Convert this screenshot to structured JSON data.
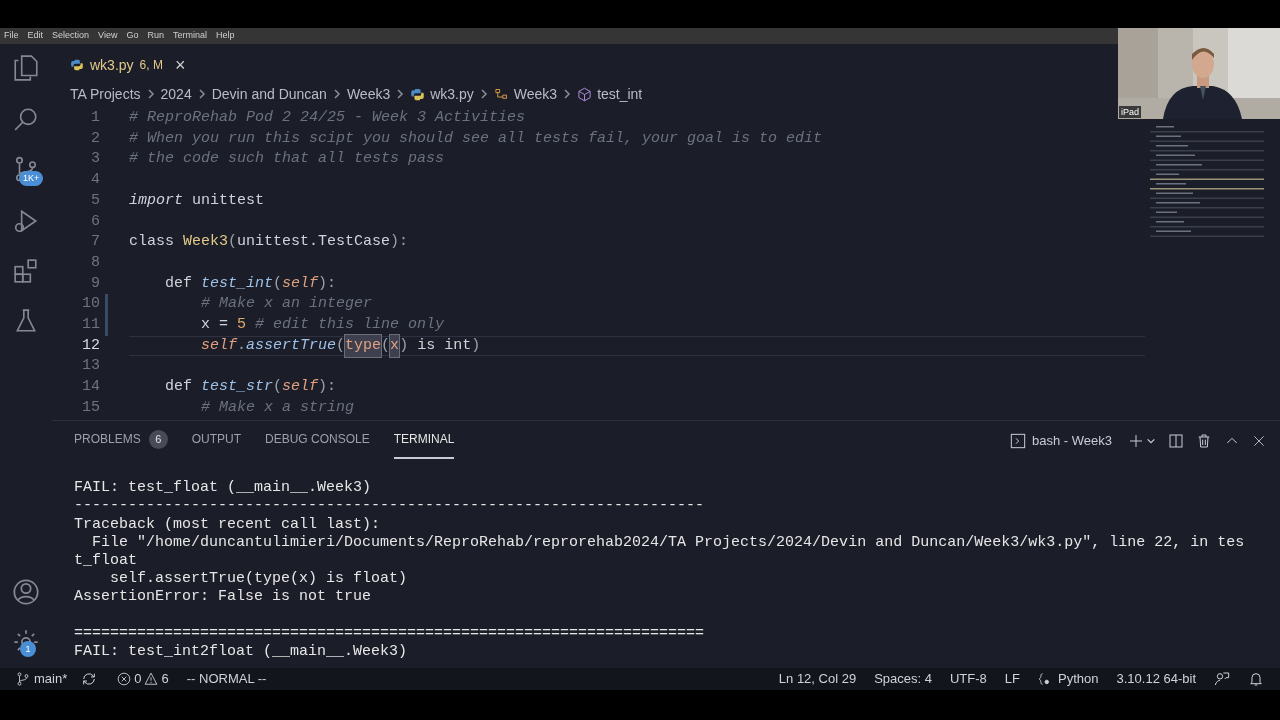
{
  "menu_bar": [
    "File",
    "Edit",
    "Selection",
    "View",
    "Go",
    "Run",
    "Terminal",
    "Help"
  ],
  "activity_bar": {
    "source_control_badge": "1K+",
    "settings_badge": "1"
  },
  "editor_tab": {
    "filename": "wk3.py",
    "status": "6, M",
    "close": "×"
  },
  "breadcrumbs": [
    {
      "text": "TA Projects",
      "kind": "folder"
    },
    {
      "text": "2024",
      "kind": "folder"
    },
    {
      "text": "Devin and Duncan",
      "kind": "folder"
    },
    {
      "text": "Week3",
      "kind": "folder"
    },
    {
      "text": "wk3.py",
      "kind": "python"
    },
    {
      "text": "Week3",
      "kind": "class"
    },
    {
      "text": "test_int",
      "kind": "method"
    }
  ],
  "code_lines": [
    {
      "number": "1",
      "current": false,
      "modified": false,
      "segments": [
        {
          "text": "# ReproRehab Pod 2 24/25 - Week 3 Activities",
          "kind": "comment"
        }
      ]
    },
    {
      "number": "2",
      "current": false,
      "modified": false,
      "segments": [
        {
          "text": "# When you run this scipt you should see all tests fail, your goal is to edit",
          "kind": "comment"
        }
      ]
    },
    {
      "number": "3",
      "current": false,
      "modified": false,
      "segments": [
        {
          "text": "# the code such that all tests pass",
          "kind": "comment"
        }
      ]
    },
    {
      "number": "4",
      "current": false,
      "modified": false
    },
    {
      "number": "5",
      "current": false,
      "modified": false,
      "segments": [
        {
          "text": "import",
          "kind": "keyword"
        },
        {
          "text": " unittest",
          "kind": "plain"
        }
      ]
    },
    {
      "number": "6",
      "current": false,
      "modified": false
    },
    {
      "number": "7",
      "current": false,
      "modified": false,
      "segments": [
        {
          "text": "class",
          "kind": "plain"
        },
        {
          "text": " Week3",
          "kind": "name"
        },
        {
          "text": "(",
          "kind": "punct"
        },
        {
          "text": "unittest.TestCase",
          "kind": "plain"
        },
        {
          "text": "):",
          "kind": "punct"
        }
      ]
    },
    {
      "number": "8",
      "current": false,
      "modified": false
    },
    {
      "number": "9",
      "current": false,
      "modified": false,
      "segments": [
        {
          "text": "    def",
          "kind": "plain"
        },
        {
          "text": " test_int",
          "kind": "func"
        },
        {
          "text": "(",
          "kind": "punct"
        },
        {
          "text": "self",
          "kind": "self"
        },
        {
          "text": "):",
          "kind": "punct"
        }
      ]
    },
    {
      "number": "10",
      "current": false,
      "modified": true,
      "segments": [
        {
          "text": "        # Make x an integer",
          "kind": "comment"
        }
      ]
    },
    {
      "number": "11",
      "current": false,
      "modified": true,
      "segments": [
        {
          "text": "        x = ",
          "kind": "plain"
        },
        {
          "text": "5",
          "kind": "number"
        },
        {
          "text": " # edit this line only",
          "kind": "comment"
        }
      ]
    },
    {
      "number": "12",
      "current": true,
      "modified": false,
      "segments": [
        {
          "text": "        self",
          "kind": "self"
        },
        {
          "text": ".",
          "kind": "punct"
        },
        {
          "text": "assertTrue",
          "kind": "func"
        },
        {
          "text": "(",
          "kind": "punct"
        },
        {
          "text": "type",
          "kind": "match"
        },
        {
          "text": "(",
          "kind": "punct"
        },
        {
          "text": "x",
          "kind": "match"
        },
        {
          "text": ")",
          "kind": "punct"
        },
        {
          "text": " is ",
          "kind": "plain"
        },
        {
          "text": "int",
          "kind": "plain"
        },
        {
          "text": ")",
          "kind": "punct"
        }
      ]
    },
    {
      "number": "13",
      "current": false,
      "modified": false
    },
    {
      "number": "14",
      "current": false,
      "modified": false,
      "segments": [
        {
          "text": "    def",
          "kind": "plain"
        },
        {
          "text": " test_str",
          "kind": "func"
        },
        {
          "text": "(",
          "kind": "punct"
        },
        {
          "text": "self",
          "kind": "self"
        },
        {
          "text": "):",
          "kind": "punct"
        }
      ]
    },
    {
      "number": "15",
      "current": false,
      "modified": false,
      "segments": [
        {
          "text": "        # Make x a string",
          "kind": "comment"
        }
      ]
    }
  ],
  "webcam": {
    "label": "iPad"
  },
  "panel": {
    "tabs": [
      {
        "label": "PROBLEMS",
        "count": "6",
        "selected": false
      },
      {
        "label": "OUTPUT",
        "selected": false
      },
      {
        "label": "DEBUG CONSOLE",
        "selected": false
      },
      {
        "label": "TERMINAL",
        "selected": true
      }
    ],
    "terminal_name": "bash - Week3",
    "terminal_blocks": [
      [
        "FAIL: test_float (__main__.Week3)",
        "----------------------------------------------------------------------",
        "Traceback (most recent call last):",
        "  File \"/home/duncantulimieri/Documents/ReproRehab/reprorehab2024/TA Projects/2024/Devin and Duncan/Week3/wk3.py\", line 22, in tes",
        "t_float",
        "    self.assertTrue(type(x) is float)",
        "AssertionError: False is not true"
      ],
      [
        "======================================================================",
        "FAIL: test_int2float (__main__.Week3)"
      ]
    ]
  },
  "status_bar": {
    "branch": "main*",
    "errors": "0",
    "warnings": "6",
    "mode": "-- NORMAL --",
    "position": "Ln 12, Col 29",
    "indent": "Spaces: 4",
    "encoding": "UTF-8",
    "eol": "LF",
    "language": "Python",
    "interpreter": "3.10.12 64-bit"
  }
}
